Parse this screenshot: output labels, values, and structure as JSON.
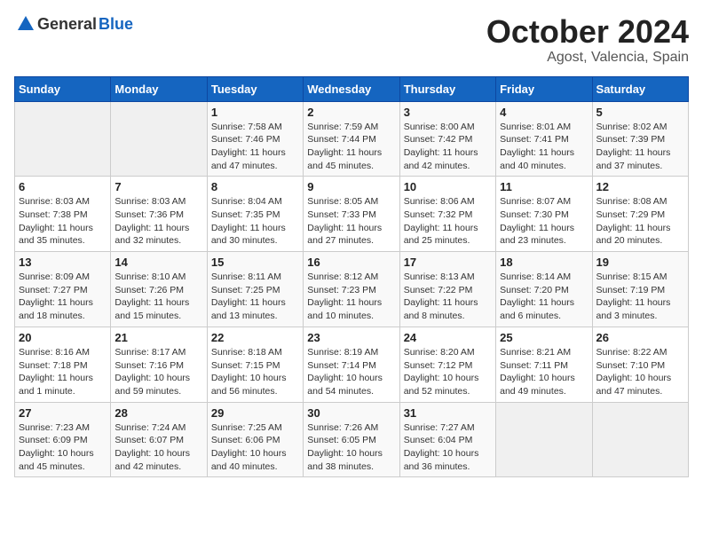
{
  "logo": {
    "text_general": "General",
    "text_blue": "Blue"
  },
  "header": {
    "month_title": "October 2024",
    "location": "Agost, Valencia, Spain"
  },
  "calendar": {
    "days_of_week": [
      "Sunday",
      "Monday",
      "Tuesday",
      "Wednesday",
      "Thursday",
      "Friday",
      "Saturday"
    ],
    "weeks": [
      [
        {
          "day": "",
          "info": ""
        },
        {
          "day": "",
          "info": ""
        },
        {
          "day": "1",
          "info": "Sunrise: 7:58 AM\nSunset: 7:46 PM\nDaylight: 11 hours and 47 minutes."
        },
        {
          "day": "2",
          "info": "Sunrise: 7:59 AM\nSunset: 7:44 PM\nDaylight: 11 hours and 45 minutes."
        },
        {
          "day": "3",
          "info": "Sunrise: 8:00 AM\nSunset: 7:42 PM\nDaylight: 11 hours and 42 minutes."
        },
        {
          "day": "4",
          "info": "Sunrise: 8:01 AM\nSunset: 7:41 PM\nDaylight: 11 hours and 40 minutes."
        },
        {
          "day": "5",
          "info": "Sunrise: 8:02 AM\nSunset: 7:39 PM\nDaylight: 11 hours and 37 minutes."
        }
      ],
      [
        {
          "day": "6",
          "info": "Sunrise: 8:03 AM\nSunset: 7:38 PM\nDaylight: 11 hours and 35 minutes."
        },
        {
          "day": "7",
          "info": "Sunrise: 8:03 AM\nSunset: 7:36 PM\nDaylight: 11 hours and 32 minutes."
        },
        {
          "day": "8",
          "info": "Sunrise: 8:04 AM\nSunset: 7:35 PM\nDaylight: 11 hours and 30 minutes."
        },
        {
          "day": "9",
          "info": "Sunrise: 8:05 AM\nSunset: 7:33 PM\nDaylight: 11 hours and 27 minutes."
        },
        {
          "day": "10",
          "info": "Sunrise: 8:06 AM\nSunset: 7:32 PM\nDaylight: 11 hours and 25 minutes."
        },
        {
          "day": "11",
          "info": "Sunrise: 8:07 AM\nSunset: 7:30 PM\nDaylight: 11 hours and 23 minutes."
        },
        {
          "day": "12",
          "info": "Sunrise: 8:08 AM\nSunset: 7:29 PM\nDaylight: 11 hours and 20 minutes."
        }
      ],
      [
        {
          "day": "13",
          "info": "Sunrise: 8:09 AM\nSunset: 7:27 PM\nDaylight: 11 hours and 18 minutes."
        },
        {
          "day": "14",
          "info": "Sunrise: 8:10 AM\nSunset: 7:26 PM\nDaylight: 11 hours and 15 minutes."
        },
        {
          "day": "15",
          "info": "Sunrise: 8:11 AM\nSunset: 7:25 PM\nDaylight: 11 hours and 13 minutes."
        },
        {
          "day": "16",
          "info": "Sunrise: 8:12 AM\nSunset: 7:23 PM\nDaylight: 11 hours and 10 minutes."
        },
        {
          "day": "17",
          "info": "Sunrise: 8:13 AM\nSunset: 7:22 PM\nDaylight: 11 hours and 8 minutes."
        },
        {
          "day": "18",
          "info": "Sunrise: 8:14 AM\nSunset: 7:20 PM\nDaylight: 11 hours and 6 minutes."
        },
        {
          "day": "19",
          "info": "Sunrise: 8:15 AM\nSunset: 7:19 PM\nDaylight: 11 hours and 3 minutes."
        }
      ],
      [
        {
          "day": "20",
          "info": "Sunrise: 8:16 AM\nSunset: 7:18 PM\nDaylight: 11 hours and 1 minute."
        },
        {
          "day": "21",
          "info": "Sunrise: 8:17 AM\nSunset: 7:16 PM\nDaylight: 10 hours and 59 minutes."
        },
        {
          "day": "22",
          "info": "Sunrise: 8:18 AM\nSunset: 7:15 PM\nDaylight: 10 hours and 56 minutes."
        },
        {
          "day": "23",
          "info": "Sunrise: 8:19 AM\nSunset: 7:14 PM\nDaylight: 10 hours and 54 minutes."
        },
        {
          "day": "24",
          "info": "Sunrise: 8:20 AM\nSunset: 7:12 PM\nDaylight: 10 hours and 52 minutes."
        },
        {
          "day": "25",
          "info": "Sunrise: 8:21 AM\nSunset: 7:11 PM\nDaylight: 10 hours and 49 minutes."
        },
        {
          "day": "26",
          "info": "Sunrise: 8:22 AM\nSunset: 7:10 PM\nDaylight: 10 hours and 47 minutes."
        }
      ],
      [
        {
          "day": "27",
          "info": "Sunrise: 7:23 AM\nSunset: 6:09 PM\nDaylight: 10 hours and 45 minutes."
        },
        {
          "day": "28",
          "info": "Sunrise: 7:24 AM\nSunset: 6:07 PM\nDaylight: 10 hours and 42 minutes."
        },
        {
          "day": "29",
          "info": "Sunrise: 7:25 AM\nSunset: 6:06 PM\nDaylight: 10 hours and 40 minutes."
        },
        {
          "day": "30",
          "info": "Sunrise: 7:26 AM\nSunset: 6:05 PM\nDaylight: 10 hours and 38 minutes."
        },
        {
          "day": "31",
          "info": "Sunrise: 7:27 AM\nSunset: 6:04 PM\nDaylight: 10 hours and 36 minutes."
        },
        {
          "day": "",
          "info": ""
        },
        {
          "day": "",
          "info": ""
        }
      ]
    ]
  }
}
